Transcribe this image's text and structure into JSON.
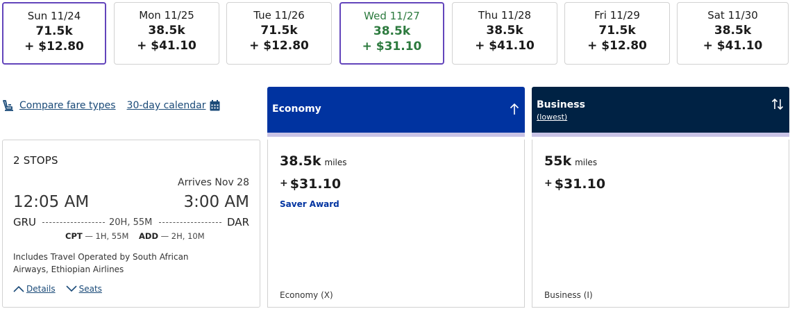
{
  "date_strip": [
    {
      "date": "Sun 11/24",
      "miles": "71.5k",
      "price": "+ $12.80",
      "selected": true,
      "lowest": false
    },
    {
      "date": "Mon 11/25",
      "miles": "38.5k",
      "price": "+ $41.10",
      "selected": false,
      "lowest": false
    },
    {
      "date": "Tue 11/26",
      "miles": "71.5k",
      "price": "+ $12.80",
      "selected": false,
      "lowest": false
    },
    {
      "date": "Wed 11/27",
      "miles": "38.5k",
      "price": "+ $31.10",
      "selected": true,
      "lowest": true
    },
    {
      "date": "Thu 11/28",
      "miles": "38.5k",
      "price": "+ $41.10",
      "selected": false,
      "lowest": false
    },
    {
      "date": "Fri 11/29",
      "miles": "71.5k",
      "price": "+ $12.80",
      "selected": false,
      "lowest": false
    },
    {
      "date": "Sat 11/30",
      "miles": "38.5k",
      "price": "+ $41.10",
      "selected": false,
      "lowest": false
    }
  ],
  "links": {
    "compare": "Compare fare types",
    "calendar": "30-day calendar"
  },
  "columns": {
    "economy": {
      "title": "Economy"
    },
    "business": {
      "title": "Business",
      "subtitle": "(lowest)"
    }
  },
  "flight": {
    "stops": "2 STOPS",
    "arrives": "Arrives Nov 28",
    "depart_time": "12:05 AM",
    "arrive_time": "3:00 AM",
    "origin": "GRU",
    "destination": "DAR",
    "duration": "20H, 55M",
    "layover1_code": "CPT",
    "layover1_time": "— 1H, 55M",
    "layover2_code": "ADD",
    "layover2_time": "— 2H, 10M",
    "operated": "Includes Travel Operated by South African Airways, Ethiopian Airlines",
    "details_label": "Details",
    "seats_label": "Seats"
  },
  "fares": {
    "economy": {
      "miles": "38.5k",
      "miles_unit": "miles",
      "plus": "+",
      "price": "$31.10",
      "award": "Saver Award",
      "fare_class": "Economy (X)"
    },
    "business": {
      "miles": "55k",
      "miles_unit": "miles",
      "plus": "+",
      "price": "$31.10",
      "fare_class": "Business (I)"
    }
  },
  "colors": {
    "selected_border": "#6244bb",
    "lowest_green": "#2c7a3e",
    "economy_header": "#0033a0",
    "business_header": "#002244",
    "link": "#1a4a78"
  }
}
